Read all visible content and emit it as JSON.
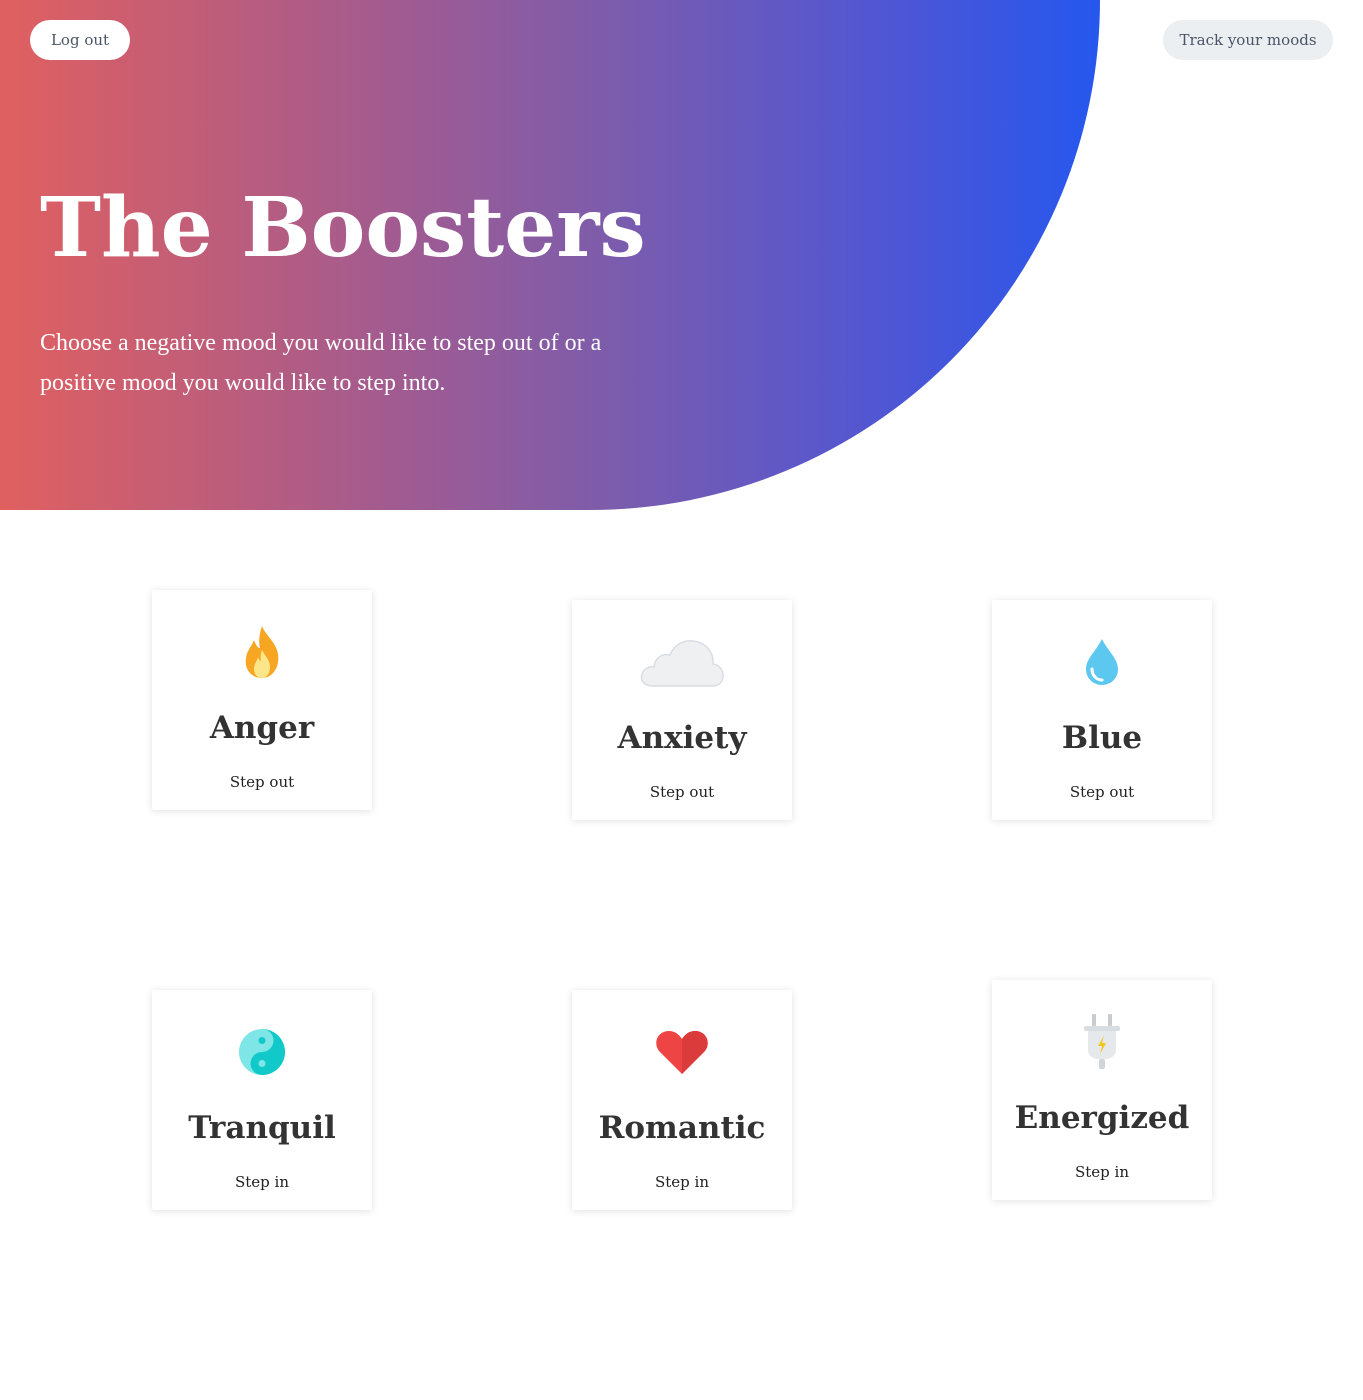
{
  "header": {
    "logout_label": "Log out",
    "track_label": "Track your moods"
  },
  "hero": {
    "title": "The Boosters",
    "subtitle": "Choose a negative mood you would like to step out of or a positive mood you would like to step into."
  },
  "colors": {
    "gradient_start": "#e06060",
    "gradient_end": "#2557ee",
    "card_bg": "#ffffff",
    "text_dark": "#333333"
  },
  "moods": [
    {
      "name": "Anger",
      "action": "Step out",
      "icon": "fire-icon"
    },
    {
      "name": "Anxiety",
      "action": "Step out",
      "icon": "cloud-icon"
    },
    {
      "name": "Blue",
      "action": "Step out",
      "icon": "droplet-icon"
    },
    {
      "name": "Tranquil",
      "action": "Step in",
      "icon": "yin-yang-icon"
    },
    {
      "name": "Romantic",
      "action": "Step in",
      "icon": "heart-icon"
    },
    {
      "name": "Energized",
      "action": "Step in",
      "icon": "plug-icon"
    }
  ]
}
